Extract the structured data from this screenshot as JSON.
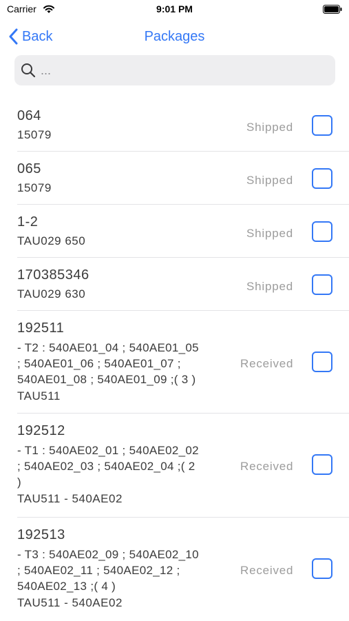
{
  "status_bar": {
    "carrier": "Carrier",
    "time": "9:01 PM"
  },
  "nav": {
    "back_label": "Back",
    "title": "Packages"
  },
  "search": {
    "placeholder": "..."
  },
  "items": [
    {
      "code": "064",
      "description": "",
      "sub": "15079",
      "status": "Shipped"
    },
    {
      "code": "065",
      "description": "",
      "sub": "15079",
      "status": "Shipped"
    },
    {
      "code": "1-2",
      "description": "",
      "sub": "TAU029 650",
      "status": "Shipped"
    },
    {
      "code": "170385346",
      "description": "",
      "sub": "TAU029 630",
      "status": "Shipped"
    },
    {
      "code": "192511",
      "description_lines": [
        "- T2 : 540AE01_04 ; 540AE01_05",
        "; 540AE01_06 ; 540AE01_07 ;",
        "540AE01_08 ; 540AE01_09 ;( 3 )"
      ],
      "sub": "TAU511",
      "status": "Received"
    },
    {
      "code": "192512",
      "description_lines": [
        "- T1 : 540AE02_01 ; 540AE02_02",
        "; 540AE02_03 ; 540AE02_04 ;( 2",
        ")"
      ],
      "sub": "TAU511 - 540AE02",
      "status": "Received"
    },
    {
      "code": "192513",
      "description_lines": [
        "- T3 : 540AE02_09 ; 540AE02_10",
        "; 540AE02_11 ; 540AE02_12 ;",
        "540AE02_13 ;( 4 )"
      ],
      "sub": "TAU511 - 540AE02",
      "status": "Received"
    }
  ]
}
